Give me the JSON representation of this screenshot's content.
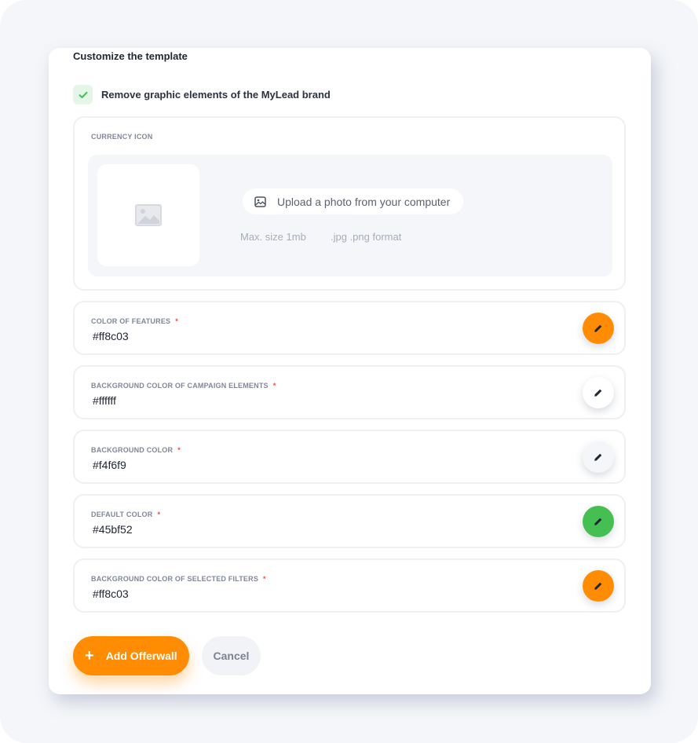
{
  "section_title": "Customize the template",
  "remove_branding": {
    "label": "Remove graphic elements of the MyLead brand",
    "checked": true
  },
  "currency_icon": {
    "label": "CURRENCY ICON",
    "upload_label": "Upload a photo from your computer",
    "max_size": "Max. size 1mb",
    "format": ".jpg .png format"
  },
  "colors": [
    {
      "label": "COLOR OF FEATURES",
      "required": "*",
      "value": "#ff8c03",
      "swatch": "#ff8c03",
      "icon": "pencil-icon"
    },
    {
      "label": "BACKGROUND COLOR OF CAMPAIGN ELEMENTS",
      "required": "*",
      "value": "#ffffff",
      "swatch": "#ffffff",
      "icon": "pencil-icon"
    },
    {
      "label": "BACKGROUND COLOR",
      "required": "*",
      "value": "#f4f6f9",
      "swatch": "#f4f6f9",
      "icon": "pencil-icon"
    },
    {
      "label": "DEFAULT COLOR",
      "required": "*",
      "value": "#45bf52",
      "swatch": "#45bf52",
      "icon": "pencil-icon"
    },
    {
      "label": "BACKGROUND COLOR OF SELECTED FILTERS",
      "required": "*",
      "value": "#ff8c03",
      "swatch": "#ff8c03",
      "icon": "pencil-icon"
    }
  ],
  "actions": {
    "primary_icon": "+",
    "primary_label": "Add Offerwall",
    "secondary_label": "Cancel"
  },
  "theme": {
    "accent": "#ff8c03",
    "success": "#45bf52",
    "page_bg": "#f4f6f9"
  }
}
